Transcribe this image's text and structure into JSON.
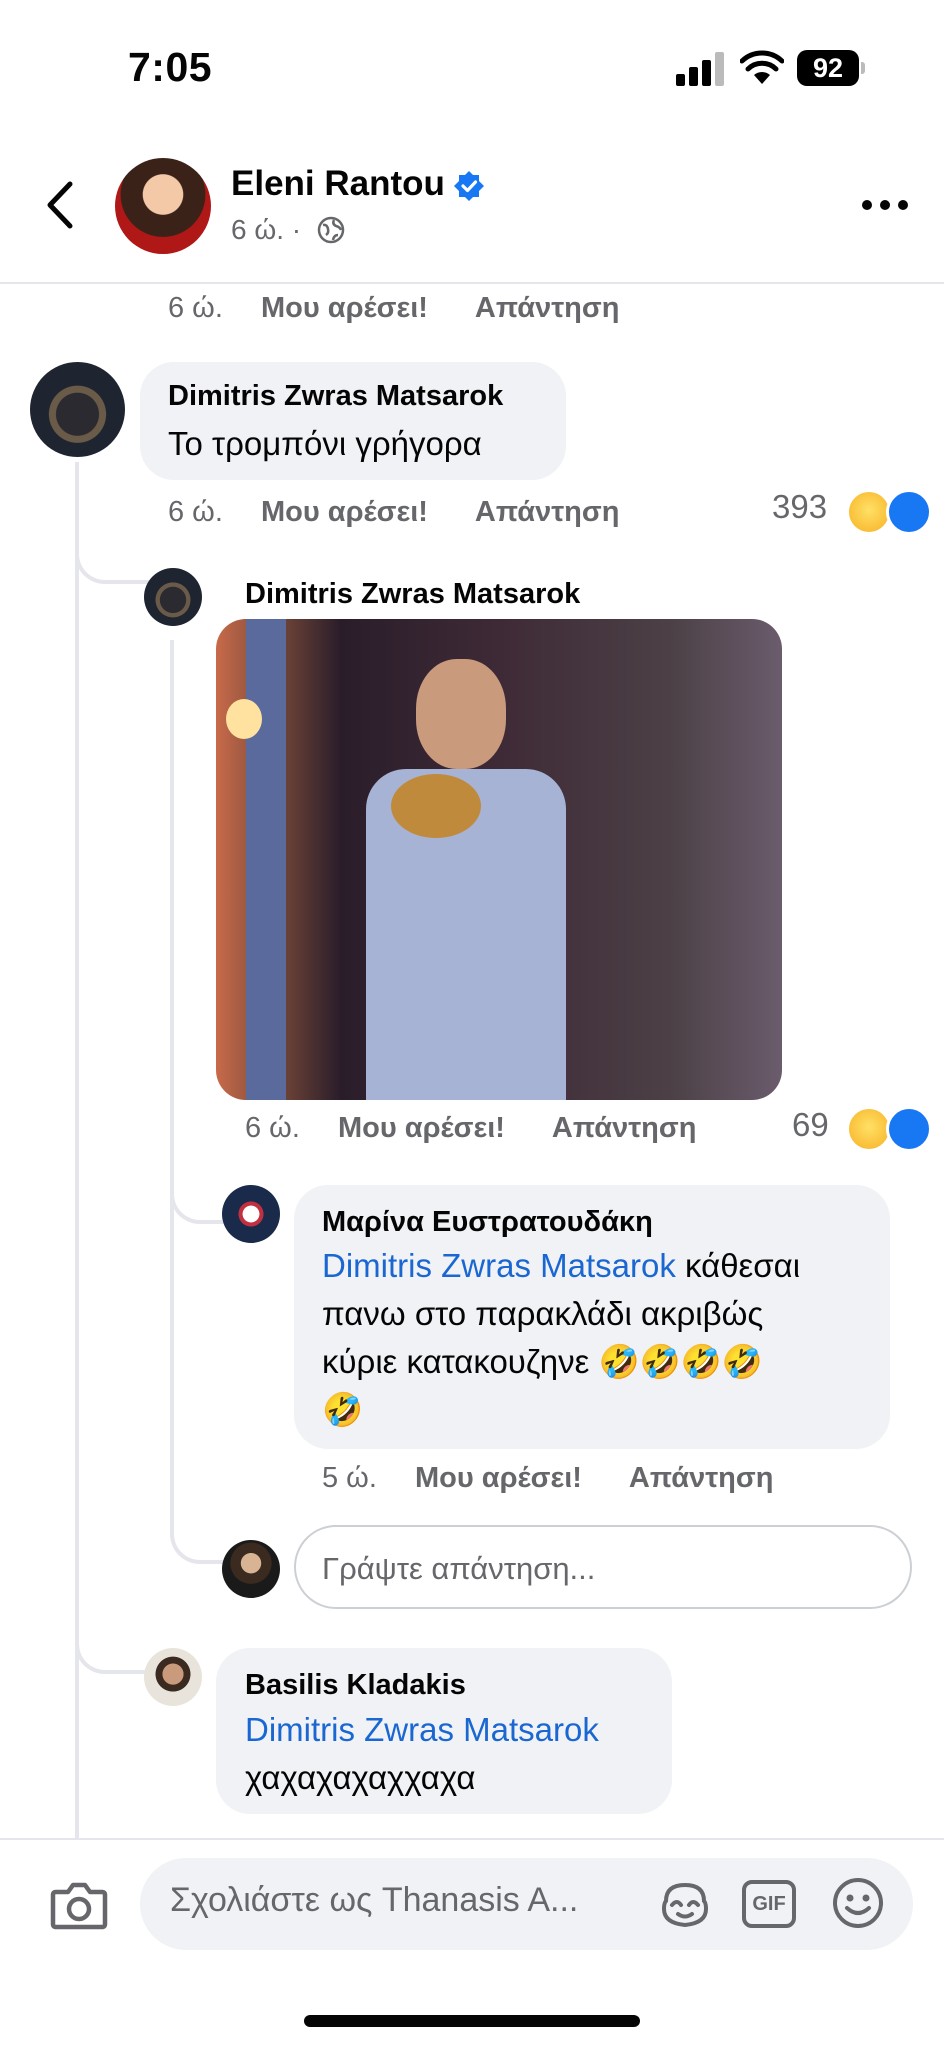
{
  "status_bar": {
    "time": "7:05",
    "battery": "92"
  },
  "header": {
    "author": "Eleni Rantou",
    "meta": "6 ώ. ·",
    "icons": [
      "back-chevron-icon",
      "verified-badge-icon",
      "globe-icon",
      "more-icon"
    ]
  },
  "labels": {
    "like": "Μου αρέσει!",
    "reply": "Απάντηση"
  },
  "top_meta": {
    "time": "6 ώ."
  },
  "comments": [
    {
      "name": "Dimitris Zwras Matsarok",
      "text": "Το τρομπόνι γρήγορα",
      "time": "6 ώ.",
      "reactions": "393"
    },
    {
      "name": "Dimitris Zwras Matsarok",
      "image_alt": "photo of man playing trombone",
      "time": "6 ώ.",
      "reactions": "69"
    },
    {
      "name": "Μαρίνα Ευστρατουδάκη",
      "mention": "Dimitris Zwras Matsarok",
      "text_line1_rest": " κάθεσαι",
      "text_line2": "πανω στο παρακλάδι ακριβώς",
      "text_line3": "κύριε κατακουζηνε 🤣🤣🤣🤣",
      "text_line4": "🤣",
      "time": "5 ώ."
    },
    {
      "name": "Basilis Kladakis",
      "mention": "Dimitris Zwras Matsarok",
      "text": "χαχαχαχαχχαχα"
    }
  ],
  "reply_input": {
    "placeholder": "Γράψτε απάντηση..."
  },
  "composer": {
    "placeholder": "Σχολιάστε ως Thanasis A...",
    "icons": [
      "camera-icon",
      "avatar-sticker-icon",
      "gif-icon",
      "emoji-icon"
    ],
    "gif_label": "GIF"
  },
  "colors": {
    "link": "#1a67d2",
    "bubble": "#f0f2f5",
    "like_blue": "#1877f2",
    "haha_yellow": "#f7b124"
  }
}
